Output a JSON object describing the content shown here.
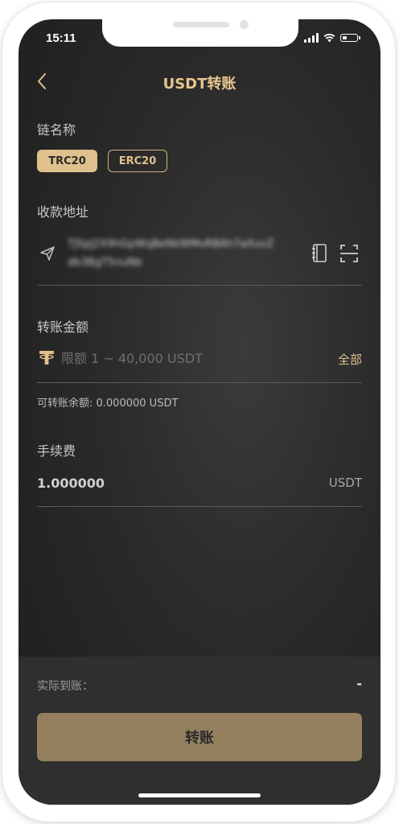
{
  "status_bar": {
    "time": "15:11",
    "icons": [
      "signal-icon",
      "wifi-icon",
      "battery-icon"
    ]
  },
  "nav": {
    "back_icon": "chevron-left-icon",
    "title": "USDT转账"
  },
  "chain": {
    "label": "链名称",
    "options": [
      "TRC20",
      "ERC20"
    ],
    "selected": "TRC20"
  },
  "address": {
    "label": "收款地址",
    "value": "TJSpJ2X9hGpWqBeNkWMvRBAh7aXuvZdb3BgT5nuNb",
    "send_icon": "send-icon",
    "book_icon": "address-book-icon",
    "scan_icon": "scan-icon"
  },
  "amount": {
    "label": "转账金额",
    "placeholder": "限额 1 ~ 40,000 USDT",
    "value": "",
    "all_label": "全部",
    "currency_icon": "tether-icon",
    "balance_text": "可转账余额: 0.000000 USDT"
  },
  "fee": {
    "label": "手续费",
    "value": "1.000000",
    "unit": "USDT"
  },
  "footer": {
    "received_label": "实际到账：",
    "received_value": "-",
    "submit_label": "转账"
  },
  "colors": {
    "accent": "#e0c08c",
    "button": "#94805f",
    "background": "#2a2a2a"
  }
}
